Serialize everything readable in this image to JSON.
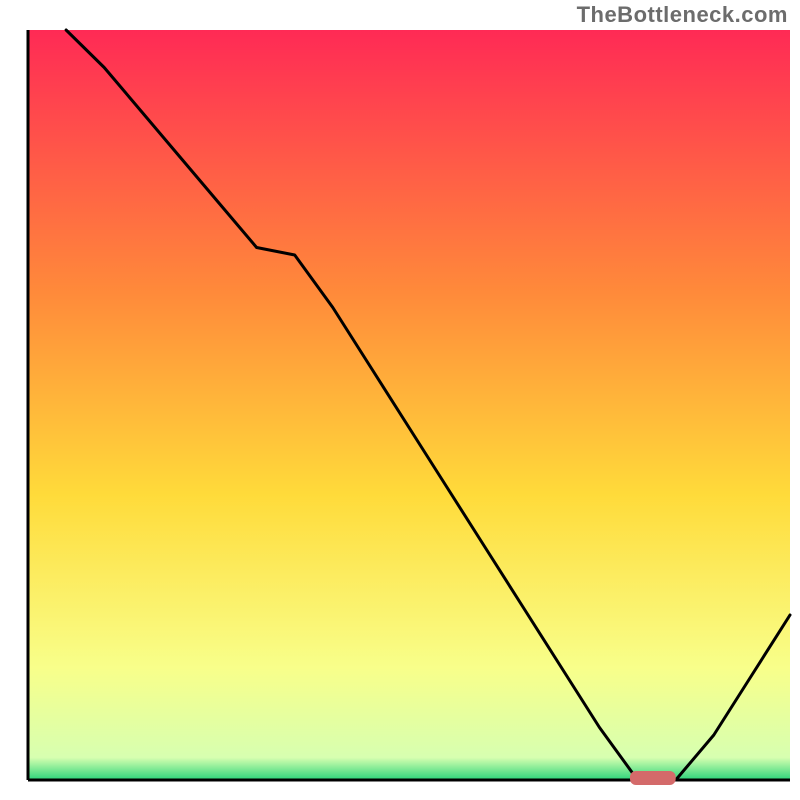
{
  "watermark": "TheBottleneck.com",
  "chart_data": {
    "type": "line",
    "title": "",
    "xlabel": "",
    "ylabel": "",
    "xlim": [
      0,
      100
    ],
    "ylim": [
      0,
      100
    ],
    "x": [
      5,
      10,
      15,
      20,
      25,
      30,
      35,
      40,
      45,
      50,
      55,
      60,
      65,
      70,
      75,
      80,
      85,
      90,
      95,
      100
    ],
    "values": [
      100,
      95,
      89,
      83,
      77,
      71,
      70,
      63,
      55,
      47,
      39,
      31,
      23,
      15,
      7,
      0,
      0,
      6,
      14,
      22
    ],
    "series_name": "bottleneck-curve",
    "background_gradient": {
      "top": "#ff2a55",
      "mid_upper": "#ff8a3a",
      "mid": "#ffdb3a",
      "lower": "#f8ff8a",
      "bottom": "#2bd47a"
    },
    "marker": {
      "x": 82,
      "y": 0,
      "color": "#d46a6a",
      "width": 6,
      "height": 1.5
    }
  }
}
